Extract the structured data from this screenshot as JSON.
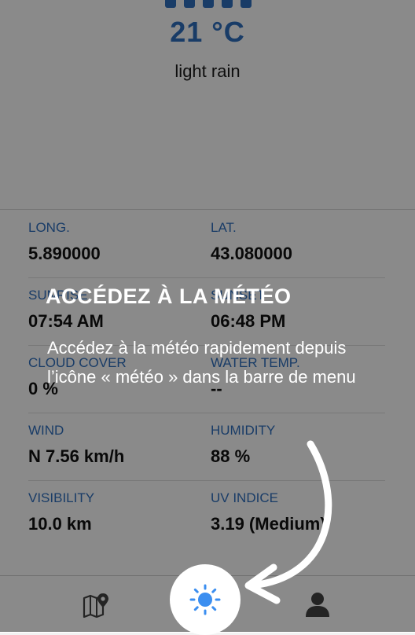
{
  "weather": {
    "temperature": "21 °C",
    "description": "light rain"
  },
  "details": [
    {
      "left": {
        "label": "LONG.",
        "value": "5.890000"
      },
      "right": {
        "label": "LAT.",
        "value": "43.080000"
      }
    },
    {
      "left": {
        "label": "SUNRISE",
        "value": "07:54 AM"
      },
      "right": {
        "label": "SUNSET",
        "value": "06:48 PM"
      }
    },
    {
      "left": {
        "label": "CLOUD COVER",
        "value": "0 %"
      },
      "right": {
        "label": "WATER TEMP.",
        "value": "--"
      }
    },
    {
      "left": {
        "label": "WIND",
        "value": "N 7.56 km/h"
      },
      "right": {
        "label": "HUMIDITY",
        "value": "88 %"
      }
    },
    {
      "left": {
        "label": "VISIBILITY",
        "value": "10.0 km"
      },
      "right": {
        "label": "UV INDICE",
        "value": "3.19 (Medium)"
      }
    }
  ],
  "tabbar": {
    "items": [
      {
        "icon": "map-pin-icon",
        "active": false
      },
      {
        "icon": "sun-icon",
        "active": true
      },
      {
        "icon": "user-icon",
        "active": false
      }
    ]
  },
  "coachmark": {
    "title": "ACCÉDEZ À LA MÉTÉO",
    "body": "Accédez à la météo rapidement depuis l’icône « météo » dans la barre de menu"
  },
  "colors": {
    "accent": "#2f6fbf",
    "sun_icon": "#3b8ef0",
    "overlay": "rgba(0,0,0,0.46)"
  }
}
